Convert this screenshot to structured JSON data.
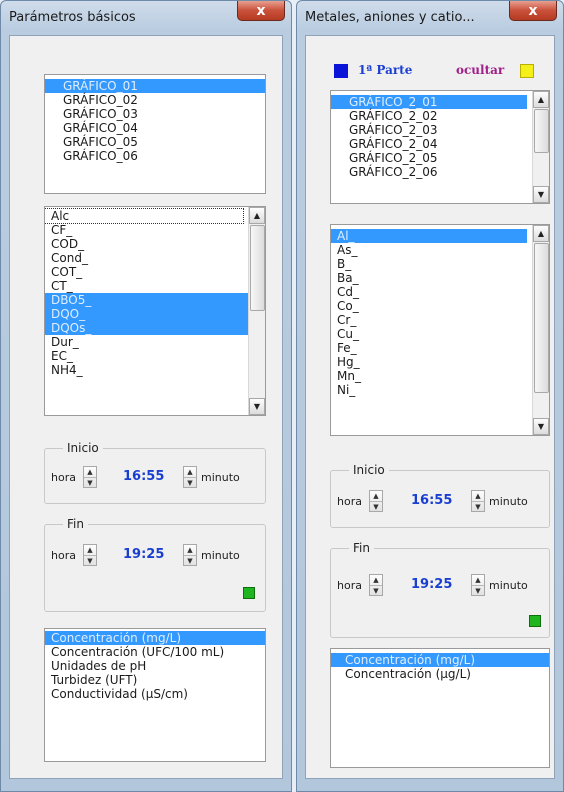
{
  "win1": {
    "title": "Parámetros básicos",
    "close_glyph": "x",
    "charts": [
      "GRÁFICO_01",
      "GRÁFICO_02",
      "GRÁFICO_03",
      "GRÁFICO_04",
      "GRÁFICO_05",
      "GRÁFICO_06"
    ],
    "params": [
      "Alc",
      "CF_",
      "COD_",
      "Cond_",
      "COT_",
      "CT_",
      "DBO5_",
      "DQO_",
      "DQOs_",
      "Dur_",
      "EC_",
      "NH4_"
    ],
    "start": {
      "legend": "Inicio",
      "hour_label": "hora",
      "time": "16:55",
      "minute_label": "minuto"
    },
    "end": {
      "legend": "Fin",
      "hour_label": "hora",
      "time": "19:25",
      "minute_label": "minuto"
    },
    "units": [
      "Concentración (mg/L)",
      "Concentración (UFC/100 mL)",
      "Unidades de pH",
      "Turbidez (UFT)",
      "Conductividad (µS/cm)"
    ]
  },
  "win2": {
    "title": "Metales, aniones y catio...",
    "close_glyph": "x",
    "part_label": "1ª Parte",
    "hide_label": "ocultar",
    "charts": [
      "GRÁFICO_2_01",
      "GRÁFICO_2_02",
      "GRÁFICO_2_03",
      "GRÁFICO_2_04",
      "GRÁFICO_2_05",
      "GRÁFICO_2_06"
    ],
    "params": [
      "Al_",
      "As_",
      "B_",
      "Ba_",
      "Cd_",
      "Co_",
      "Cr_",
      "Cu_",
      "Fe_",
      "Hg_",
      "Mn_",
      "Ni_"
    ],
    "start": {
      "legend": "Inicio",
      "hour_label": "hora",
      "time": "16:55",
      "minute_label": "minuto"
    },
    "end": {
      "legend": "Fin",
      "hour_label": "hora",
      "time": "19:25",
      "minute_label": "minuto"
    },
    "units": [
      "Concentración (mg/L)",
      "Concentración (µg/L)"
    ]
  },
  "colors": {
    "blue_square": "#0a14d8",
    "yellow_square": "#f5f01a",
    "indicator": "#1fb51f",
    "selection": "#3399ff"
  },
  "icons": {
    "spin_up": "▲",
    "spin_down": "▼",
    "scroll_up": "▲",
    "scroll_down": "▼"
  }
}
